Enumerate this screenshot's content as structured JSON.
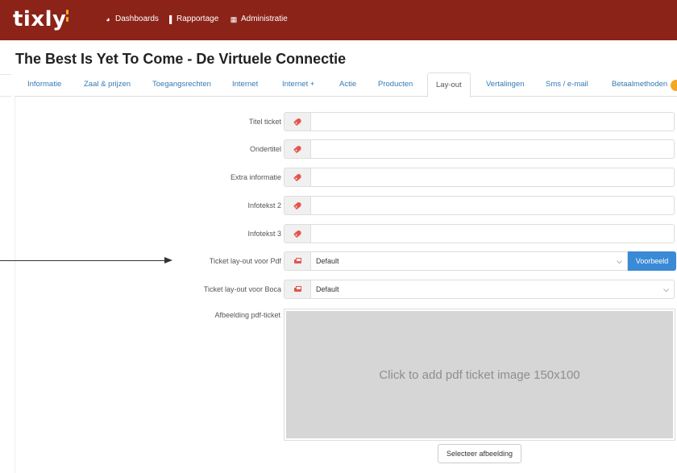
{
  "app": {
    "logo": "tixly"
  },
  "nav": [
    {
      "label": "Dashboards",
      "icon": "gauge-icon"
    },
    {
      "label": "Rapportage",
      "icon": "bar-chart-icon"
    },
    {
      "label": "Administratie",
      "icon": "database-icon"
    }
  ],
  "page": {
    "title": "The Best Is Yet To Come - De Virtuele Connectie"
  },
  "tabs": [
    {
      "label": "Informatie",
      "active": false
    },
    {
      "label": "Zaal & prijzen",
      "active": false
    },
    {
      "label": "Toegangsrechten",
      "active": false
    },
    {
      "label": "Internet",
      "active": false
    },
    {
      "label": "Internet +",
      "active": false
    },
    {
      "label": "Actie",
      "active": false
    },
    {
      "label": "Producten",
      "active": false
    },
    {
      "label": "Lay-out",
      "active": true
    },
    {
      "label": "Vertalingen",
      "active": false
    },
    {
      "label": "Sms / e-mail",
      "active": false
    },
    {
      "label": "Betaalmethoden",
      "active": false
    }
  ],
  "form": {
    "fields": [
      {
        "label": "Titel ticket",
        "value": "",
        "icon": "tag-icon"
      },
      {
        "label": "Ondertitel",
        "value": "",
        "icon": "tag-icon"
      },
      {
        "label": "Extra informatie",
        "value": "",
        "icon": "tag-icon"
      },
      {
        "label": "Infotekst 2",
        "value": "",
        "icon": "tag-icon"
      },
      {
        "label": "Infotekst 3",
        "value": "",
        "icon": "tag-icon"
      }
    ],
    "pdf_layout": {
      "label": "Ticket lay-out voor Pdf",
      "value": "Default",
      "button": "Voorbeeld",
      "icon": "printer-icon"
    },
    "boca_layout": {
      "label": "Ticket lay-out voor Boca",
      "value": "Default",
      "icon": "printer-icon"
    },
    "image": {
      "label": "Afbeelding pdf-ticket",
      "placeholder": "Click to add pdf ticket image 150x100",
      "button": "Selecteer afbeelding"
    }
  },
  "colors": {
    "topbar": "#8b2318",
    "accent": "#f5a623",
    "primary_button": "#3a8ad6",
    "icon": "#e8534a",
    "tab_link": "#337ab7"
  }
}
